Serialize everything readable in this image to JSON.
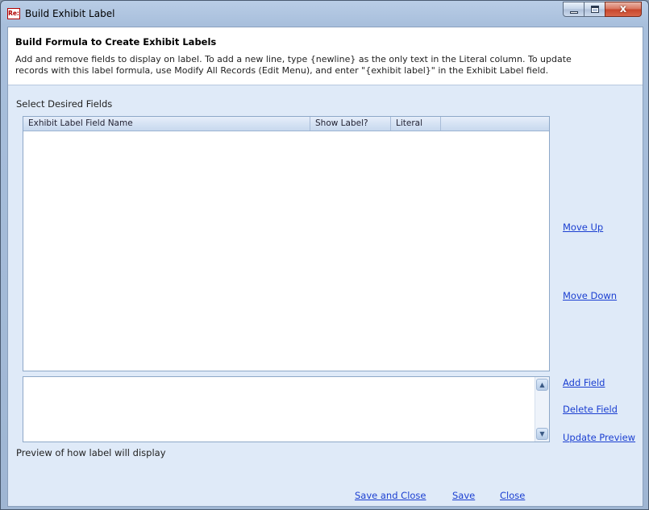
{
  "window": {
    "icon_text": "Re:",
    "title": "Build Exhibit Label",
    "controls": {
      "minimize": "minimize-icon",
      "maximize": "maximize-icon",
      "close": "close-icon"
    },
    "close_glyph": "x"
  },
  "banner": {
    "title": "Build Formula to Create Exhibit Labels",
    "description": "Add and remove fields to display on label.  To add a new line, type {newline} as the only text in the Literal column.  To update\nrecords with this label formula, use Modify All Records (Edit Menu), and enter \"{exhibit label}\" in the Exhibit Label field."
  },
  "fields_section": {
    "label": "Select Desired Fields",
    "columns": [
      "Exhibit Label Field Name",
      "Show Label?",
      "Literal"
    ],
    "rows": []
  },
  "preview": {
    "value": "",
    "label": "Preview of how label will display"
  },
  "side_actions": {
    "move_up": "Move Up",
    "move_down": "Move Down",
    "add_field": "Add Field",
    "delete_field": "Delete Field",
    "update_preview": "Update Preview"
  },
  "footer_actions": {
    "save_and_close": "Save and Close",
    "save": "Save",
    "close": "Close"
  },
  "colors": {
    "link": "#1b3fd1",
    "client_bg": "#dfeaf8",
    "close_button": "#c7452a"
  }
}
